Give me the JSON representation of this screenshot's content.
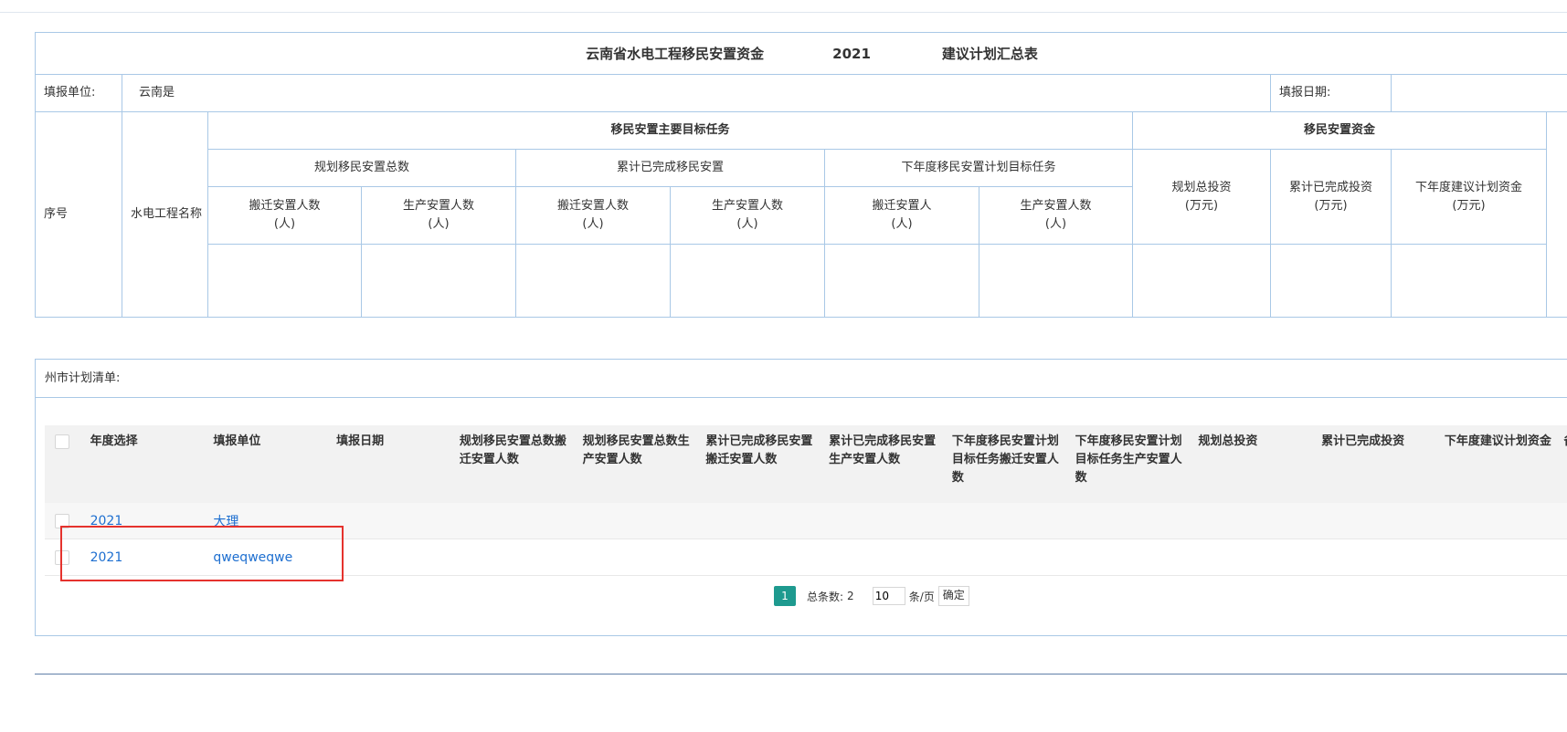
{
  "summary": {
    "title_part1": "云南省水电工程移民安置资金",
    "title_year": "2021",
    "title_part2": "建议计划汇总表",
    "unit_label": "填报单位:",
    "unit_value": "云南是",
    "date_label": "填报日期:",
    "col_index": "序号",
    "col_project": "水电工程名称",
    "group_tasks": "移民安置主要目标任务",
    "group_funds": "移民安置资金",
    "sub_planned": "规划移民安置总数",
    "sub_completed": "累计已完成移民安置",
    "sub_next": "下年度移民安置计划目标任务",
    "h_relocate_count": "搬迁安置人数",
    "h_production_count": "生产安置人数",
    "h_relocate_person": "搬迁安置人",
    "unit_person": "(人)",
    "h_total_invest": "规划总投资",
    "h_completed_invest": "累计已完成投资",
    "h_next_fund": "下年度建议计划资金",
    "unit_wan": "(万元)"
  },
  "list": {
    "title": "州市计划清单:",
    "columns": [
      "年度选择",
      "填报单位",
      "填报日期",
      "规划移民安置总数搬迁安置人数",
      "规划移民安置总数生产安置人数",
      "累计已完成移民安置搬迁安置人数",
      "累计已完成移民安置生产安置人数",
      "下年度移民安置计划目标任务搬迁安置人数",
      "下年度移民安置计划目标任务生产安置人数",
      "规划总投资",
      "累计已完成投资",
      "下年度建议计划资金",
      "备注"
    ],
    "rows": [
      {
        "year": "2021",
        "unit": "大理"
      },
      {
        "year": "2021",
        "unit": "qweqweqwe"
      }
    ]
  },
  "pager": {
    "current_page": "1",
    "total_label": "总条数:",
    "total": "2",
    "page_size": "10",
    "per_page_label": "条/页",
    "confirm": "确定"
  }
}
